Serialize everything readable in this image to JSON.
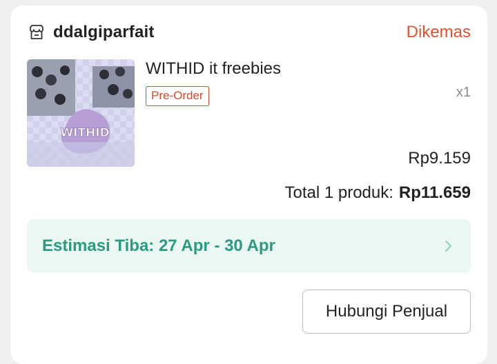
{
  "order": {
    "shop_name": "ddalgiparfait",
    "status": "Dikemas",
    "status_color": "#e2522d",
    "shop_icon": "store-icon"
  },
  "product": {
    "name": "WITHID it freebies",
    "badge": "Pre-Order",
    "quantity": "x1",
    "price": "Rp9.159",
    "image_text": "WITHID"
  },
  "summary": {
    "total_label": "Total 1 produk:",
    "total_amount": "Rp11.659"
  },
  "delivery": {
    "estimate": "Estimasi Tiba: 27 Apr - 30 Apr",
    "accent_color": "#2a9a80"
  },
  "actions": {
    "contact_seller": "Hubungi Penjual"
  }
}
